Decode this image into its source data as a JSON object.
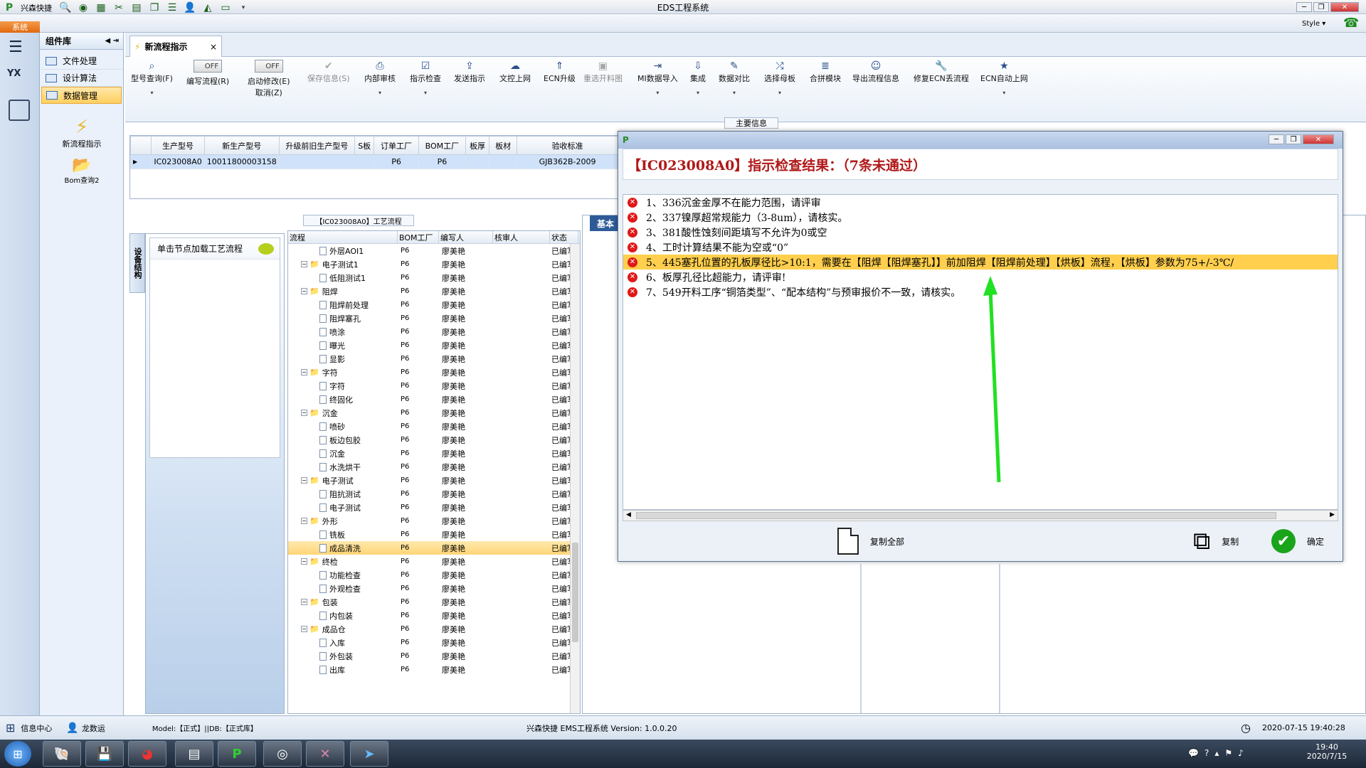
{
  "window": {
    "title": "EDS工程系统",
    "quick_access_label": "兴森快捷",
    "system_button": "系统",
    "style_label": "Style"
  },
  "left_panel": {
    "header": "组件库",
    "items": [
      {
        "label": "文件处理"
      },
      {
        "label": "设计算法"
      },
      {
        "label": "数据管理",
        "selected": true
      }
    ],
    "shortcuts": [
      {
        "label": "新流程指示"
      },
      {
        "label": "Bom查询2"
      }
    ]
  },
  "tab": {
    "label": "新流程指示",
    "close": "×"
  },
  "ribbon": {
    "buttons": [
      {
        "label": "型号查询(F)"
      },
      {
        "label": "编写流程(R)",
        "toggle": "OFF"
      },
      {
        "label": "启动修改(E)",
        "toggle": "OFF",
        "sub": "取消(Z)"
      },
      {
        "label": "保存信息(S)",
        "disabled": true
      },
      {
        "label": "内部审核"
      },
      {
        "label": "指示检查"
      },
      {
        "label": "发送指示"
      },
      {
        "label": "文控上网"
      },
      {
        "label": "ECN升级"
      },
      {
        "label": "重选开料图",
        "disabled": true
      },
      {
        "label": "MI数据导入"
      },
      {
        "label": "集成"
      },
      {
        "label": "数据对比"
      },
      {
        "label": "选择母板"
      },
      {
        "label": "合拼模块"
      },
      {
        "label": "导出流程信息"
      },
      {
        "label": "修复ECN丢流程"
      },
      {
        "label": "ECN自动上网"
      }
    ]
  },
  "main_info": {
    "label": "主要信息",
    "columns": [
      "生产型号",
      "新生产型号",
      "升级前旧生产型号",
      "S板",
      "订单工厂",
      "BOM工厂",
      "板厚",
      "板材",
      "验收标准"
    ],
    "row": [
      "IC023008A0",
      "10011800003158",
      "",
      "",
      "P6",
      "P6",
      "",
      "",
      "GJB362B-2009"
    ]
  },
  "flow": {
    "title": "【IC023008A0】工艺流程",
    "vertical_tab": "设备结构",
    "hint": "单击节点加载工艺流程",
    "columns": [
      "流程",
      "BOM工厂",
      "编写人",
      "核审人",
      "状态"
    ],
    "rows": [
      {
        "name": "外层AOI1",
        "level": 2,
        "factory": "P6",
        "writer": "廖美艳",
        "status": "已编写"
      },
      {
        "name": "电子测试1",
        "level": 1,
        "folder": true,
        "factory": "P6",
        "writer": "廖美艳",
        "status": "已编写"
      },
      {
        "name": "低阻测试1",
        "level": 2,
        "factory": "P6",
        "writer": "廖美艳",
        "status": "已编写"
      },
      {
        "name": "阻焊",
        "level": 1,
        "folder": true,
        "factory": "P6",
        "writer": "廖美艳",
        "status": "已编写"
      },
      {
        "name": "阻焊前处理",
        "level": 2,
        "factory": "P6",
        "writer": "廖美艳",
        "status": "已编写"
      },
      {
        "name": "阻焊塞孔",
        "level": 2,
        "factory": "P6",
        "writer": "廖美艳",
        "status": "已编写"
      },
      {
        "name": "喷涂",
        "level": 2,
        "factory": "P6",
        "writer": "廖美艳",
        "status": "已编写"
      },
      {
        "name": "曝光",
        "level": 2,
        "factory": "P6",
        "writer": "廖美艳",
        "status": "已编写"
      },
      {
        "name": "显影",
        "level": 2,
        "factory": "P6",
        "writer": "廖美艳",
        "status": "已编写"
      },
      {
        "name": "字符",
        "level": 1,
        "folder": true,
        "factory": "P6",
        "writer": "廖美艳",
        "status": "已编写"
      },
      {
        "name": "字符",
        "level": 2,
        "factory": "P6",
        "writer": "廖美艳",
        "status": "已编写"
      },
      {
        "name": "终固化",
        "level": 2,
        "factory": "P6",
        "writer": "廖美艳",
        "status": "已编写"
      },
      {
        "name": "沉金",
        "level": 1,
        "folder": true,
        "factory": "P6",
        "writer": "廖美艳",
        "status": "已编写"
      },
      {
        "name": "喷砂",
        "level": 2,
        "factory": "P6",
        "writer": "廖美艳",
        "status": "已编写"
      },
      {
        "name": "板边包胶",
        "level": 2,
        "factory": "P6",
        "writer": "廖美艳",
        "status": "已编写"
      },
      {
        "name": "沉金",
        "level": 2,
        "factory": "P6",
        "writer": "廖美艳",
        "status": "已编写"
      },
      {
        "name": "水洗烘干",
        "level": 2,
        "factory": "P6",
        "writer": "廖美艳",
        "status": "已编写"
      },
      {
        "name": "电子测试",
        "level": 1,
        "folder": true,
        "factory": "P6",
        "writer": "廖美艳",
        "status": "已编写"
      },
      {
        "name": "阻抗测试",
        "level": 2,
        "factory": "P6",
        "writer": "廖美艳",
        "status": "已编写"
      },
      {
        "name": "电子测试",
        "level": 2,
        "factory": "P6",
        "writer": "廖美艳",
        "status": "已编写"
      },
      {
        "name": "外形",
        "level": 1,
        "folder": true,
        "factory": "P6",
        "writer": "廖美艳",
        "status": "已编写"
      },
      {
        "name": "铣板",
        "level": 2,
        "factory": "P6",
        "writer": "廖美艳",
        "status": "已编写"
      },
      {
        "name": "成品清洗",
        "level": 2,
        "factory": "P6",
        "writer": "廖美艳",
        "status": "已编写",
        "selected": true
      },
      {
        "name": "终检",
        "level": 1,
        "folder": true,
        "factory": "P6",
        "writer": "廖美艳",
        "status": "已编写"
      },
      {
        "name": "功能检查",
        "level": 2,
        "factory": "P6",
        "writer": "廖美艳",
        "status": "已编写"
      },
      {
        "name": "外观检查",
        "level": 2,
        "factory": "P6",
        "writer": "廖美艳",
        "status": "已编写"
      },
      {
        "name": "包装",
        "level": 1,
        "folder": true,
        "factory": "P6",
        "writer": "廖美艳",
        "status": "已编写"
      },
      {
        "name": "内包装",
        "level": 2,
        "factory": "P6",
        "writer": "廖美艳",
        "status": "已编写"
      },
      {
        "name": "成品仓",
        "level": 1,
        "folder": true,
        "factory": "P6",
        "writer": "廖美艳",
        "status": "已编写"
      },
      {
        "name": "入库",
        "level": 2,
        "factory": "P6",
        "writer": "廖美艳",
        "status": "已编写"
      },
      {
        "name": "外包装",
        "level": 2,
        "factory": "P6",
        "writer": "廖美艳",
        "status": "已编写"
      },
      {
        "name": "出库",
        "level": 2,
        "factory": "P6",
        "writer": "廖美艳",
        "status": "已编写"
      }
    ]
  },
  "right_tab": {
    "label": "基本"
  },
  "dialog": {
    "header": "【IC023008A0】指示检查结果：（7条未通过）",
    "messages": [
      {
        "text": "1、336沉金金厚不在能力范围，请评审"
      },
      {
        "text": "2、337镍厚超常规能力（3-8um），请核实。"
      },
      {
        "text": "3、381酸性蚀刻间距填写不允许为0或空"
      },
      {
        "text": "4、工时计算结果不能为空或“0”"
      },
      {
        "text": "5、445塞孔位置的孔板厚径比>10:1，需要在【阻焊【阻焊塞孔】】前加阻焊【阻焊前处理】【烘板】流程，【烘板】参数为75+/-3℃/",
        "selected": true
      },
      {
        "text": "6、板厚孔径比超能力，请评审!"
      },
      {
        "text": "7、549开料工序“铜箔类型”、“配本结构”与预审报价不一致，请核实。"
      }
    ],
    "copy_all": "复制全部",
    "copy": "复制",
    "ok": "确定"
  },
  "status": {
    "info_center": "信息中心",
    "user": "龙数运",
    "model": "Model:【正式】||DB:【正式库】",
    "app": "兴森快捷 EMS工程系统 Version: 1.0.0.20",
    "datetime": "2020-07-15 19:40:28"
  },
  "taskbar": {
    "time": "19:40",
    "date": "2020/7/15"
  }
}
